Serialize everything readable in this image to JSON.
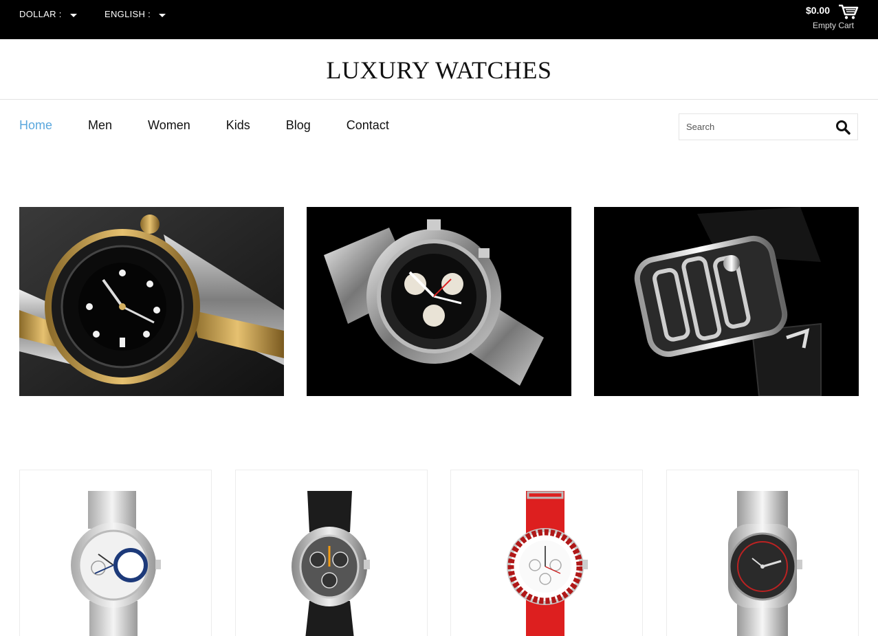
{
  "topbar": {
    "currency_label": "DOLLAR :",
    "language_label": "ENGLISH :",
    "cart_total": "$0.00",
    "cart_status": "Empty Cart"
  },
  "brand": {
    "title": "LUXURY WATCHES"
  },
  "nav": {
    "items": [
      {
        "label": "Home",
        "active": true
      },
      {
        "label": "Men",
        "active": false
      },
      {
        "label": "Women",
        "active": false
      },
      {
        "label": "Kids",
        "active": false
      },
      {
        "label": "Blog",
        "active": false
      },
      {
        "label": "Contact",
        "active": false
      }
    ]
  },
  "search": {
    "placeholder": "Search",
    "value": ""
  },
  "colors": {
    "accent": "#5aa7dd",
    "topbar_bg": "#000000",
    "text": "#111111"
  },
  "icons": {
    "cart": "shopping-cart-icon",
    "search": "magnifier-icon",
    "caret": "caret-down-icon"
  }
}
